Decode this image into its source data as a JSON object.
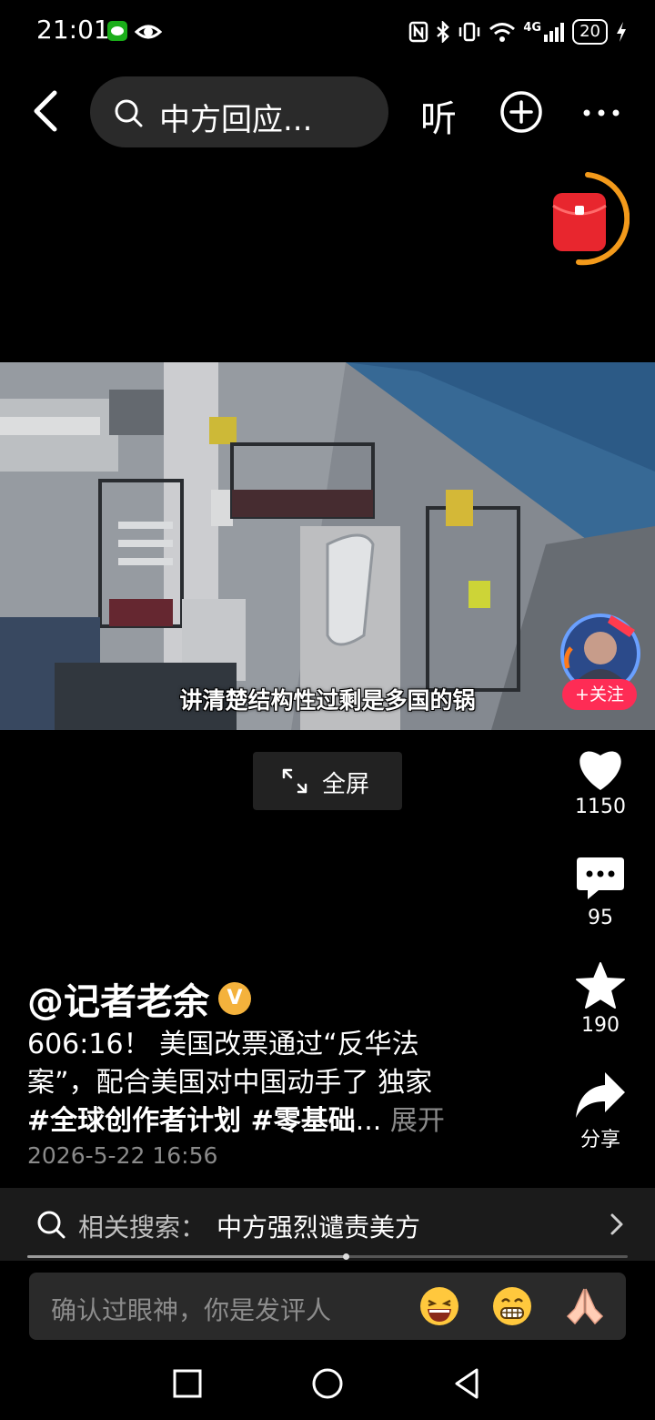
{
  "status_bar": {
    "time": "21:01",
    "network": "4G",
    "battery": "20",
    "icons": [
      "wechat-icon",
      "eye-icon",
      "nfc-icon",
      "bluetooth-icon",
      "vibrate-icon",
      "wifi-icon",
      "signal-icon",
      "battery-icon",
      "charging-icon"
    ]
  },
  "header": {
    "search_text": "中方回应...",
    "listen_label": "听"
  },
  "video": {
    "caption": "讲清楚结构性过剩是多国的锅",
    "follow_label": "+关注"
  },
  "fullscreen": {
    "label": "全屏"
  },
  "actions": {
    "likes": "1150",
    "comments": "95",
    "favorites": "190",
    "share_label": "分享"
  },
  "post": {
    "author": "@记者老余",
    "verified_mark": "V",
    "desc_line1": "606:16！ 美国改票通过“反华法",
    "desc_line2": "案”，配合美国对中国动手了 独家",
    "hashtags": "#全球创作者计划  #零基础",
    "ellipsis": "...",
    "expand_label": " 展开",
    "date": "2026-5-22 16:56"
  },
  "related_search": {
    "prefix": "相关搜索：",
    "query": "中方强烈谴责美方"
  },
  "progress": {
    "value": 0.53
  },
  "comment_bar": {
    "placeholder": "确认过眼神，你是发评人",
    "emojis": [
      "laughing-emoji-icon",
      "grinning-emoji-icon",
      "praying-hands-icon"
    ]
  },
  "colors": {
    "follow_red": "#fe2c55",
    "verified_gold": "#f4b23c",
    "red_packet": "#e8262e",
    "timer_ring": "#f39a1b"
  }
}
